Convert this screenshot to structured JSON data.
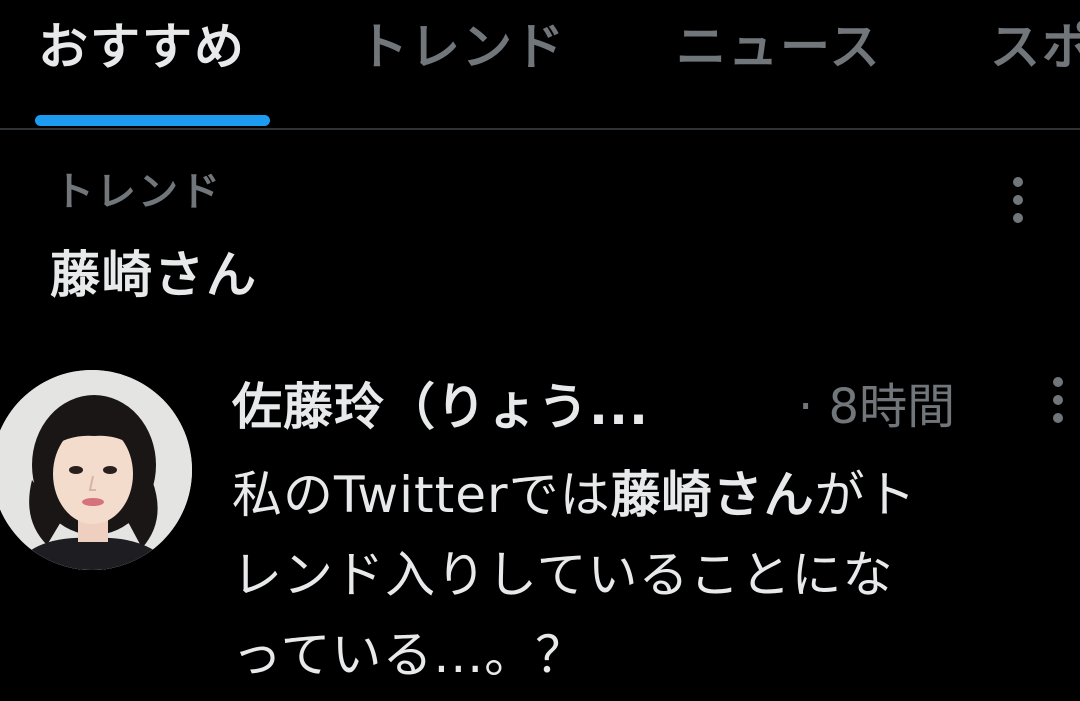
{
  "tabs": [
    {
      "label": "おすすめ",
      "active": true
    },
    {
      "label": "トレンド",
      "active": false
    },
    {
      "label": "ニュース",
      "active": false
    },
    {
      "label": "スポ",
      "active": false
    }
  ],
  "trend": {
    "category": "トレンド",
    "name": "藤崎さん"
  },
  "tweet": {
    "author": "佐藤玲（りょう...",
    "separator": "·",
    "time": "8時間",
    "body": {
      "line1_pre": "私のTwitterでは",
      "line1_bold": "藤崎さん",
      "line1_post": "がト",
      "line2": "レンド入りしていることにな",
      "line3": "っている...。？"
    }
  },
  "colors": {
    "background": "#000000",
    "primary_text": "#e7e9ea",
    "secondary_text": "#71767b",
    "accent": "#1d9bf0",
    "divider": "#2f3336"
  },
  "icons": [
    "more-vertical-icon",
    "avatar-photo"
  ]
}
